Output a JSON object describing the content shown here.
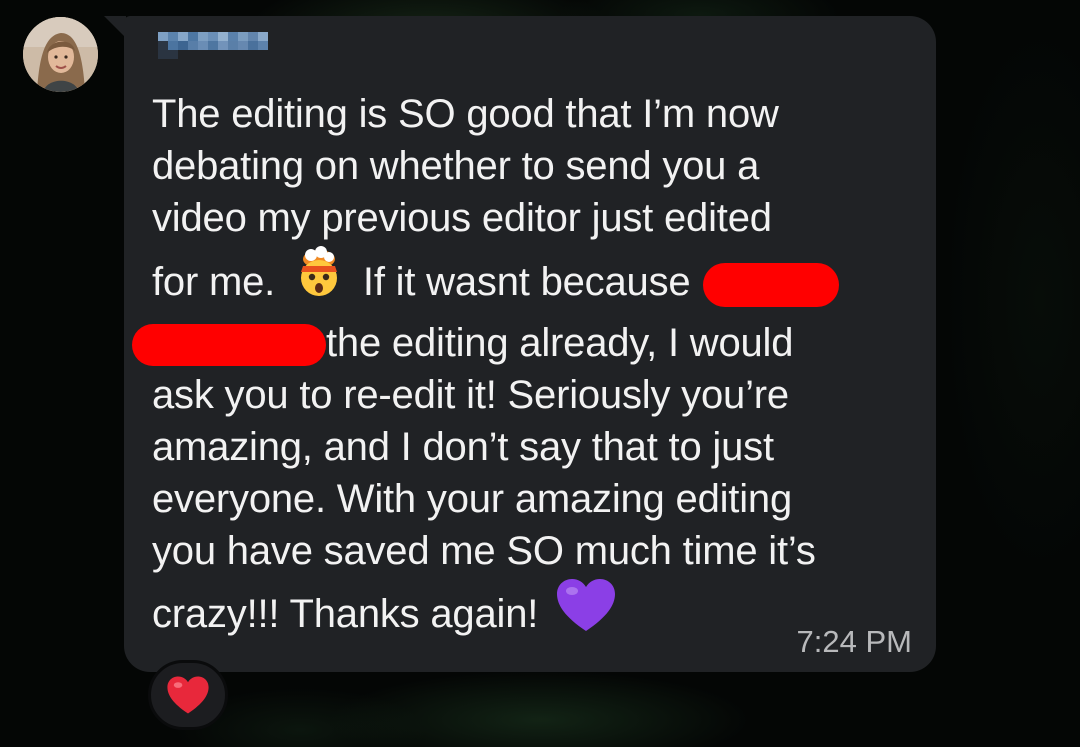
{
  "sender": {
    "avatar_icon": "profile-photo-avatar",
    "name_redacted": true
  },
  "message": {
    "lines": [
      "The editing is SO good that I’m now",
      "debating on whether to send you a",
      "video my previous editor just edited",
      "for me.",
      "If it wasnt because",
      "the editing already, I would",
      "ask you to re-edit it! Seriously you’re",
      "amazing, and I don’t say that to just",
      "everyone. With your amazing editing",
      "you have saved me SO much time it’s",
      "crazy!!! Thanks again!"
    ],
    "emojis": [
      "exploding-head-emoji",
      "purple-heart-emoji"
    ],
    "timestamp": "7:24 PM"
  },
  "reaction": {
    "icon": "red-heart-icon"
  },
  "colors": {
    "bubble": "#202225",
    "text": "#f2f2f2",
    "timestamp": "#b8b9bb",
    "redaction": "#ff0000",
    "background": "#040605"
  }
}
